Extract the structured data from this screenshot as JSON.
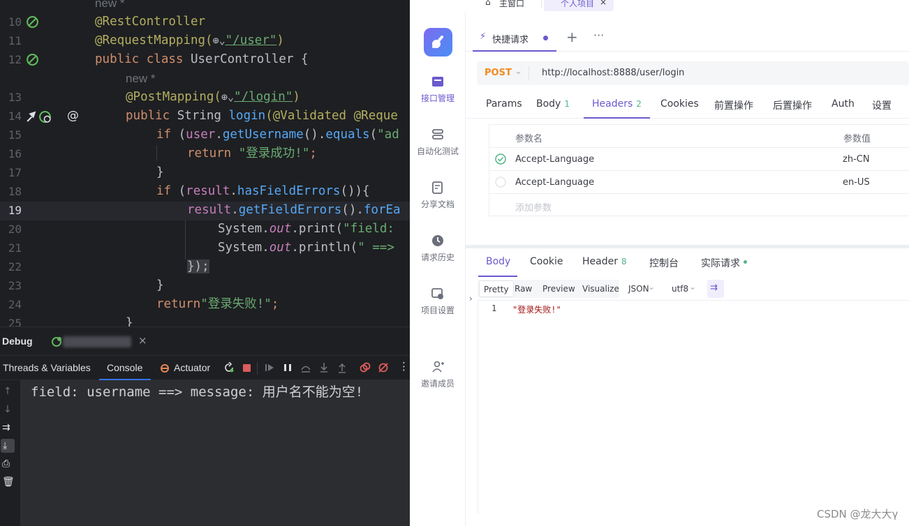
{
  "editor": {
    "line_numbers": [
      "10",
      "11",
      "12",
      "13",
      "14",
      "15",
      "16",
      "17",
      "18",
      "19",
      "20",
      "21",
      "22",
      "23",
      "24",
      "25"
    ],
    "hint_new": "new *",
    "lines": {
      "l10": "@RestController",
      "l11_a": "@RequestMapping(",
      "l11_b": "\"/user\"",
      "l11_c": ")",
      "l12_a": "public class",
      "l12_b": " UserController {",
      "l13_a": "@PostMapping(",
      "l13_b": "\"/login\"",
      "l13_c": ")",
      "l14_a": "public",
      "l14_b": " String ",
      "l14_c": "login",
      "l14_d": "(@Validated @Reque",
      "l15_a": "if",
      "l15_b": " (",
      "l15_c": "user",
      "l15_d": ".",
      "l15_e": "getUsername",
      "l15_f": "().",
      "l15_g": "equals",
      "l15_h": "(",
      "l15_i": "\"ad",
      "l16_a": "return",
      "l16_b": " \"登录成功!\"",
      "l16_c": ";",
      "l17": "}",
      "l18_a": "if",
      "l18_b": " (",
      "l18_c": "result",
      "l18_d": ".",
      "l18_e": "hasFieldErrors",
      "l18_f": "()){",
      "l19_a": "result",
      "l19_b": ".",
      "l19_c": "getFieldErrors",
      "l19_d": "().",
      "l19_e": "forEa",
      "l20_a": "System.",
      "l20_b": "out",
      "l20_c": ".print(",
      "l20_d": "\"field: ",
      "l21_a": "System.",
      "l21_b": "out",
      "l21_c": ".println(",
      "l21_d": "\" ==> ",
      "l22": "});",
      "l23": "}",
      "l24_a": "return",
      "l24_b": "\"登录失败!\"",
      "l24_c": ";",
      "l25": "}"
    }
  },
  "debug": {
    "title": "Debug",
    "tabs": [
      "Threads & Variables",
      "Console",
      "Actuator"
    ],
    "console_output": "field: username ==> message: 用户名不能为空!"
  },
  "api": {
    "top_tabs": [
      "主窗口",
      "个人项目"
    ],
    "nav": [
      "接口管理",
      "自动化测试",
      "分享文档",
      "请求历史",
      "项目设置",
      "邀请成员"
    ],
    "tab_title": "快捷请求",
    "method": "POST",
    "url": "http://localhost:8888/user/login",
    "req_tabs": {
      "params": "Params",
      "body": "Body",
      "body_count": "1",
      "headers": "Headers",
      "headers_count": "2",
      "cookies": "Cookies",
      "pre": "前置操作",
      "post": "后置操作",
      "auth": "Auth",
      "settings": "设置"
    },
    "table": {
      "col_name": "参数名",
      "col_value": "参数值",
      "rows": [
        {
          "name": "Accept-Language",
          "value": "zh-CN"
        },
        {
          "name": "Accept-Language",
          "value": "en-US"
        }
      ],
      "add_placeholder": "添加参数"
    },
    "res_tabs": {
      "body": "Body",
      "cookie": "Cookie",
      "header": "Header",
      "header_count": "8",
      "console": "控制台",
      "actual": "实际请求"
    },
    "formats": [
      "Pretty",
      "Raw",
      "Preview",
      "Visualize",
      "JSON",
      "utf8"
    ],
    "response_line_no": "1",
    "response_text": "\"登录失败!\""
  },
  "watermark": "CSDN @龙大大γ"
}
